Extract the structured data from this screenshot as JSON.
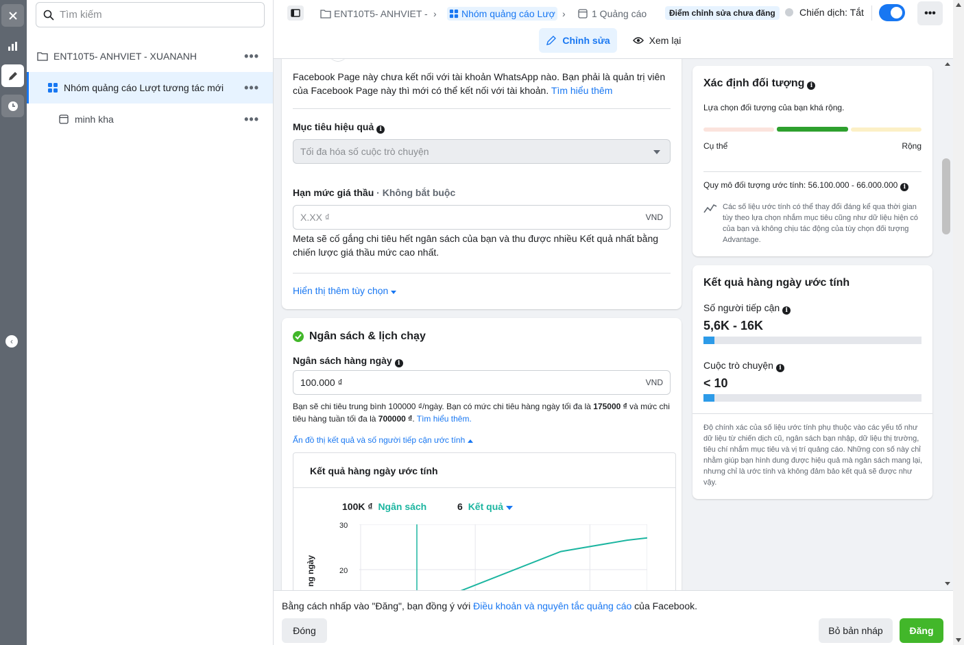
{
  "leftbar": {
    "icons": [
      "close-icon",
      "chart-icon",
      "pencil-icon",
      "clock-icon",
      "collapse-icon"
    ]
  },
  "search": {
    "placeholder": "Tìm kiếm"
  },
  "tree": [
    {
      "label": "ENT10T5- ANHVIET - XUANANH",
      "icon": "folder-icon"
    },
    {
      "label": "Nhóm quảng cáo Lượt tương tác mới",
      "icon": "grid-icon"
    },
    {
      "label": "minh kha",
      "icon": "ad-icon"
    }
  ],
  "topbar": {
    "crumbs": [
      "ENT10T5- ANHVIET -",
      "Nhóm quảng cáo Lượ",
      "1 Quảng cáo"
    ],
    "draft_badge": "Điểm chỉnh sửa chưa đăng",
    "campaign_status": "Chiến dịch: Tắt",
    "tab_edit": "Chỉnh sửa",
    "tab_review": "Xem lại"
  },
  "form": {
    "whatsapp_note": "Facebook Page này chưa kết nối với tài khoản WhatsApp nào. Bạn phải là quản trị viên của Facebook Page này thì mới có thể kết nối với tài khoản.",
    "learn_more": "Tìm hiểu thêm",
    "goal_label": "Mục tiêu hiệu quả",
    "goal_value": "Tối đa hóa số cuộc trò chuyện",
    "bid_label": "Hạn mức giá thầu",
    "bid_optional": "· Không bắt buộc",
    "bid_placeholder": "X.XX ₫",
    "currency": "VND",
    "bid_note": "Meta sẽ cố gắng chi tiêu hết ngân sách của bạn và thu được nhiều Kết quả nhất bằng chiến lược giá thầu mức cao nhất.",
    "more_options": "Hiển thị thêm tùy chọn"
  },
  "budget": {
    "title": "Ngân sách & lịch chạy",
    "daily_label": "Ngân sách hàng ngày",
    "daily_value": "100.000 ₫",
    "currency": "VND",
    "note_prefix": "Bạn sẽ chi tiêu trung bình 100000 ₫/ngày. Bạn có mức chi tiêu hàng ngày tối đa là ",
    "max_daily": "175000 ₫",
    "note_mid": " và mức chi tiêu hàng tuần tối đa là ",
    "max_weekly": "700000 ₫",
    "note_link": "Tìm hiểu thêm.",
    "hide_chart": "Ẩn đồ thị kết quả và số người tiếp cận ước tính"
  },
  "chart_panel": {
    "title": "Kết quả hàng ngày ước tính",
    "budget_value": "100K ₫",
    "budget_label": "Ngân sách",
    "results_value": "6",
    "results_label": "Kết quả",
    "ylabel": "ng ngày",
    "yticks": [
      "30",
      "20"
    ]
  },
  "chart_data": {
    "type": "line",
    "ylim": [
      0,
      30
    ],
    "yticks": [
      20,
      30
    ],
    "series": [
      {
        "values": [
          [
            0.3,
            14
          ],
          [
            0.7,
            24
          ],
          [
            0.93,
            26.5
          ],
          [
            1.0,
            27
          ]
        ]
      }
    ],
    "grid": true
  },
  "audience": {
    "title": "Xác định đối tượng",
    "subtitle": "Lựa chọn đối tượng của bạn khá rộng.",
    "left_label": "Cụ thể",
    "right_label": "Rộng",
    "size_text": "Quy mô đối tượng ước tính: 56.100.000 - 66.000.000",
    "disclaimer": "Các số liệu ước tính có thể thay đổi đáng kể qua thời gian tùy theo lựa chọn nhắm mục tiêu cũng như dữ liệu hiện có của bạn và không chịu tác động của tùy chọn đối tượng Advantage."
  },
  "daily_results": {
    "title": "Kết quả hàng ngày ước tính",
    "reach_label": "Số người tiếp cận",
    "reach_value": "5,6K - 16K",
    "convo_label": "Cuộc trò chuyện",
    "convo_value": "< 10",
    "accuracy_note": "Độ chính xác của số liệu ước tính phụ thuộc vào các yếu tố như dữ liệu từ chiến dịch cũ, ngân sách bạn nhập, dữ liệu thị trường, tiêu chí nhắm mục tiêu và vị trí quảng cáo. Những con số này chỉ nhằm giúp bạn hình dung được hiệu quả mà ngân sách mang lại, nhưng chỉ là ước tính và không đảm bảo kết quả sẽ được như vậy."
  },
  "footer": {
    "agree_prefix": "Bằng cách nhấp vào \"Đăng\", bạn đồng ý với ",
    "agree_link": "Điều khoản và nguyên tắc quảng cáo",
    "agree_suffix": " của Facebook.",
    "close": "Đóng",
    "discard": "Bỏ bản nháp",
    "publish": "Đăng"
  },
  "colors": {
    "accent": "#1877f2",
    "publish": "#42b72a",
    "teal": "#1bb5a0"
  }
}
